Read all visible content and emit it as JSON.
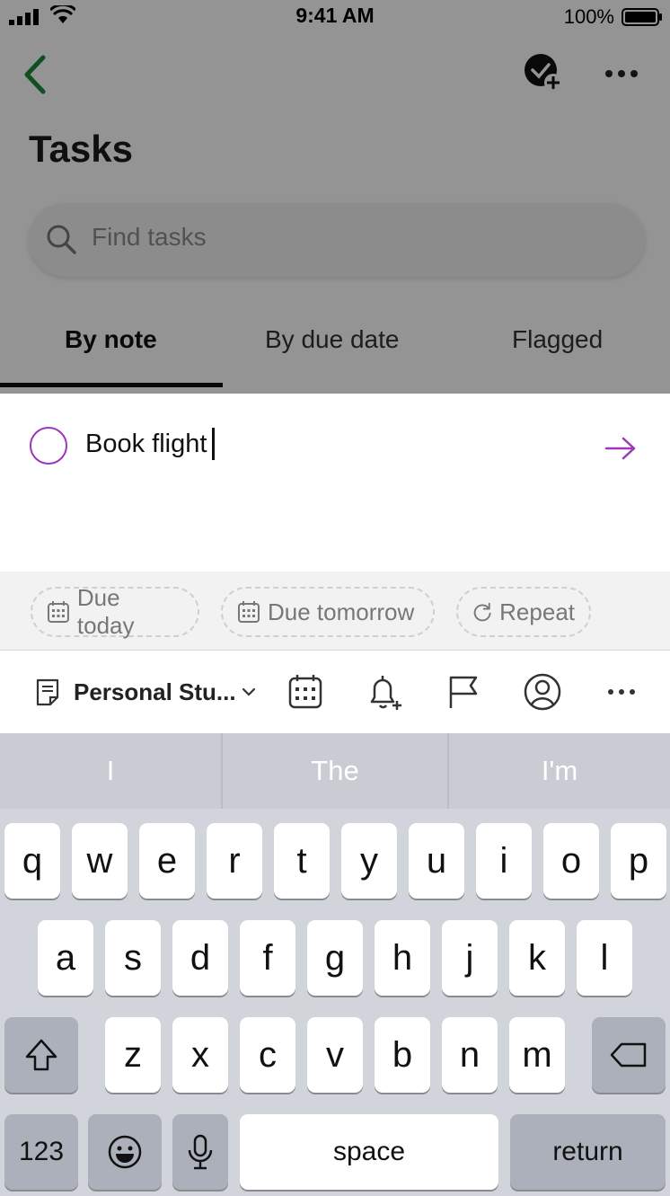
{
  "status_bar": {
    "time": "9:41 AM",
    "battery_percent": "100%"
  },
  "header": {
    "title": "Tasks"
  },
  "search": {
    "placeholder": "Find tasks"
  },
  "tabs": [
    {
      "label": "By note",
      "selected": true
    },
    {
      "label": "By due date",
      "selected": false
    },
    {
      "label": "Flagged",
      "selected": false
    }
  ],
  "task": {
    "text": "Book flight"
  },
  "chips": [
    {
      "label": "Due today",
      "icon": "calendar-icon"
    },
    {
      "label": "Due tomorrow",
      "icon": "calendar-icon"
    },
    {
      "label": "Repeat",
      "icon": "repeat-icon"
    }
  ],
  "toolbar": {
    "notebook_label": "Personal Stu..."
  },
  "keyboard": {
    "suggestions": [
      "I",
      "The",
      "I'm"
    ],
    "row1": [
      "q",
      "w",
      "e",
      "r",
      "t",
      "y",
      "u",
      "i",
      "o",
      "p"
    ],
    "row2": [
      "a",
      "s",
      "d",
      "f",
      "g",
      "h",
      "j",
      "k",
      "l"
    ],
    "row3": [
      "z",
      "x",
      "c",
      "v",
      "b",
      "n",
      "m"
    ],
    "numbers_key": "123",
    "space_key": "space",
    "return_key": "return"
  },
  "colors": {
    "accent_purple": "#9b39b6",
    "back_green": "#1b8a3a",
    "keyboard_bg": "#d1d4da"
  }
}
